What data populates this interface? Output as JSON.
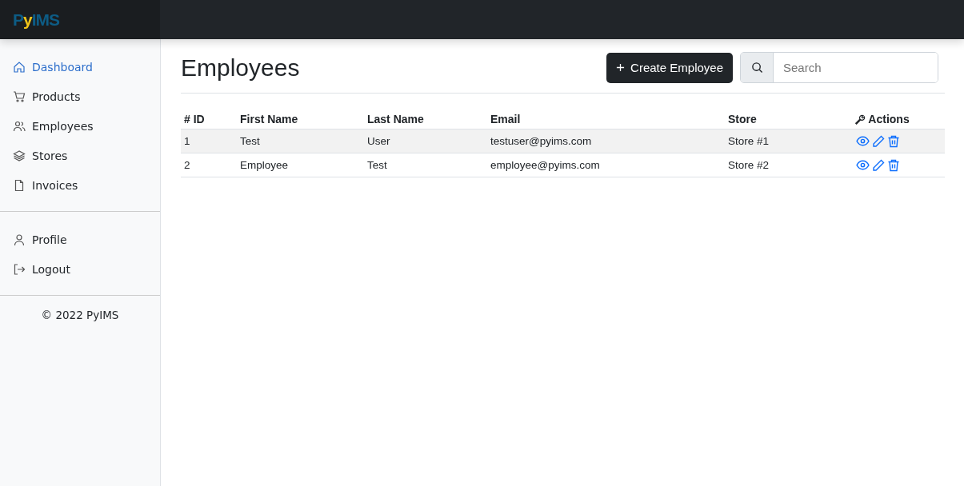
{
  "logo": {
    "before": "P",
    "accent": "y",
    "after": "IMS"
  },
  "sidebar": {
    "items": [
      {
        "label": "Dashboard",
        "kind": "home",
        "selected": true
      },
      {
        "label": "Products",
        "kind": "cart",
        "selected": false
      },
      {
        "label": "Employees",
        "kind": "people",
        "selected": false
      },
      {
        "label": "Stores",
        "kind": "layers",
        "selected": false
      },
      {
        "label": "Invoices",
        "kind": "file",
        "selected": false
      }
    ],
    "account_items": [
      {
        "label": "Profile",
        "kind": "person",
        "selected": false
      },
      {
        "label": "Logout",
        "kind": "logout",
        "selected": false
      }
    ],
    "footer": "© 2022 PyIMS"
  },
  "page": {
    "title": "Employees",
    "create_button": "Create Employee",
    "search": {
      "placeholder": "Search"
    }
  },
  "table": {
    "columns": [
      "# ID",
      "First Name",
      "Last Name",
      "Email",
      "Store",
      "Actions"
    ],
    "rows": [
      {
        "id": "1",
        "first_name": "Test",
        "last_name": "User",
        "email": "testuser@pyims.com",
        "store": "Store #1"
      },
      {
        "id": "2",
        "first_name": "Employee",
        "last_name": "Test",
        "email": "employee@pyims.com",
        "store": "Store #2"
      }
    ]
  }
}
